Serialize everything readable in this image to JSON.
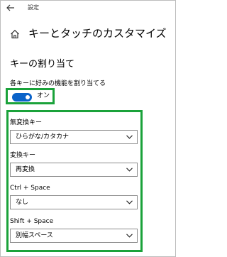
{
  "window": {
    "title": "設定"
  },
  "header": {
    "page_title": "キーとタッチのカスタマイズ"
  },
  "section": {
    "title": "キーの割り当て",
    "toggle_caption": "各キーに好みの機能を割り当てる",
    "toggle_state": "オン",
    "toggle_on": true
  },
  "fields": [
    {
      "label": "無変換キー",
      "value": "ひらがな/カタカナ"
    },
    {
      "label": "変換キー",
      "value": "再変換"
    },
    {
      "label": "Ctrl + Space",
      "value": "なし"
    },
    {
      "label": "Shift + Space",
      "value": "別幅スペース"
    }
  ],
  "colors": {
    "accent": "#0a63c9",
    "highlight_border": "#1aa23a"
  }
}
